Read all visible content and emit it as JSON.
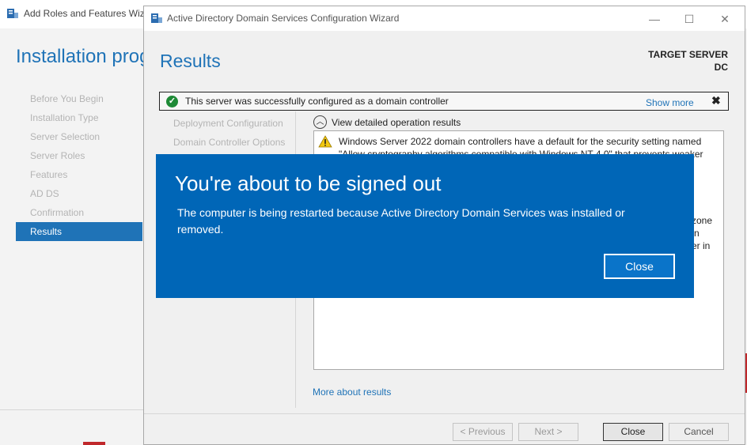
{
  "background_window": {
    "title": "Add Roles and Features Wizard",
    "heading": "Installation progress",
    "steps": [
      {
        "label": "Before You Begin",
        "active": false
      },
      {
        "label": "Installation Type",
        "active": false
      },
      {
        "label": "Server Selection",
        "active": false
      },
      {
        "label": "Server Roles",
        "active": false
      },
      {
        "label": "Features",
        "active": false
      },
      {
        "label": "AD DS",
        "active": false
      },
      {
        "label": "Confirmation",
        "active": false
      },
      {
        "label": "Results",
        "active": true
      }
    ]
  },
  "wizard": {
    "title": "Active Directory Domain Services Configuration Wizard",
    "window_controls": {
      "minimize": "—",
      "maximize": "☐",
      "close": "✕"
    },
    "heading": "Results",
    "target_server_label": "TARGET SERVER",
    "target_server_name": "DC",
    "status_bar": {
      "icon": "check-circle-icon",
      "message": "This server was successfully configured as a domain controller",
      "show_more": "Show more",
      "close": "✖"
    },
    "steps": [
      {
        "label": "Deployment Configuration"
      },
      {
        "label": "Domain Controller Options"
      }
    ],
    "view_detailed": "View detailed operation results",
    "warning": {
      "icon": "warning-icon",
      "line1": "Windows Server 2022 domain controllers have a default for the security setting named",
      "line2": "\"Allow cryptography algorithms compatible with Windows NT 4.0\" that prevents weaker",
      "fragments": [
        "zone",
        "n",
        "er in"
      ]
    },
    "more_about_results": "More about results",
    "buttons": {
      "previous": "< Previous",
      "next": "Next >",
      "close": "Close",
      "cancel": "Cancel"
    },
    "colors": {
      "accent": "#1f73b7",
      "success": "#1e8a36",
      "warning": "#f2c811"
    }
  },
  "signout_dialog": {
    "title": "You're about to be signed out",
    "message": "The computer is being restarted because Active Directory Domain Services was installed or removed.",
    "close_label": "Close",
    "background_color": "#0066b7"
  }
}
